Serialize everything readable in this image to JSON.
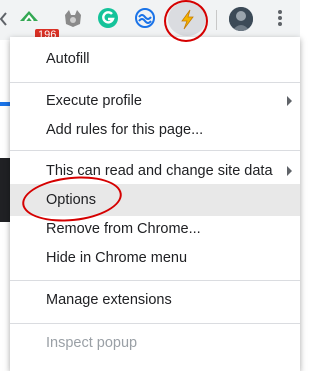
{
  "toolbar": {
    "badge_count": "196",
    "icons": [
      "extension-arrow-icon",
      "fox-extension-icon",
      "grammarly-icon",
      "sync-extension-icon",
      "lightning-extension-icon",
      "profile-avatar-icon",
      "chrome-menu-icon"
    ]
  },
  "menu": {
    "autofill": "Autofill",
    "execute_profile": "Execute profile",
    "add_rules": "Add rules for this page...",
    "site_data": "This can read and change site data",
    "options": "Options",
    "remove": "Remove from Chrome...",
    "hide": "Hide in Chrome menu",
    "manage": "Manage extensions",
    "inspect": "Inspect popup"
  },
  "colors": {
    "annotation": "#d50000",
    "badge": "#d93025",
    "grammarly": "#15c39a"
  }
}
